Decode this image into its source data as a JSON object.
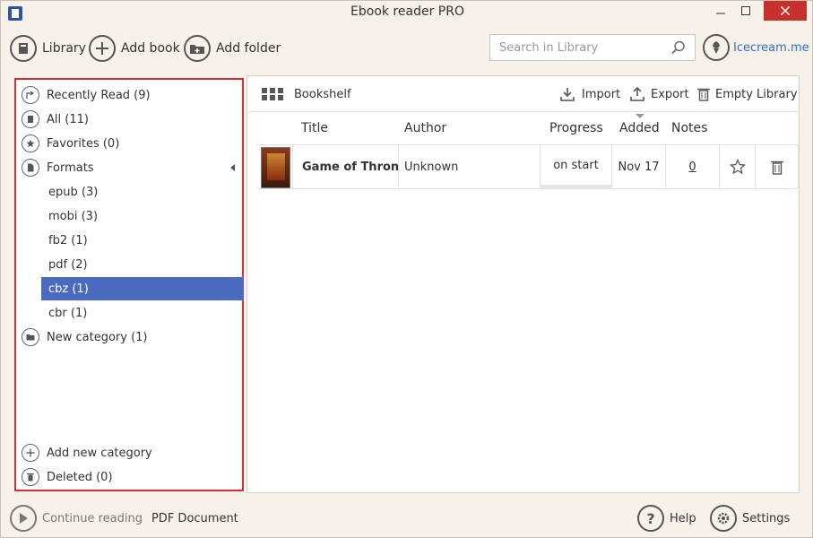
{
  "window": {
    "title": "Ebook reader PRO"
  },
  "toolbar": {
    "library_label": "Library",
    "add_book_label": "Add book",
    "add_folder_label": "Add folder",
    "search_placeholder": "Search in Library",
    "brand_label": "Icecream.me"
  },
  "sidebar": {
    "recently_read": "Recently Read (9)",
    "all": "All (11)",
    "favorites": "Favorites (0)",
    "formats": "Formats",
    "formats_list": [
      "epub (3)",
      "mobi (3)",
      "fb2 (1)",
      "pdf (2)",
      "cbz (1)",
      "cbr (1)"
    ],
    "selected_format": "cbz (1)",
    "new_category": "New category (1)",
    "add_new_category": "Add new category",
    "deleted": "Deleted (0)"
  },
  "main": {
    "view_label": "Bookshelf",
    "import_label": "Import",
    "export_label": "Export",
    "empty_library_label": "Empty Library",
    "columns": [
      "Title",
      "Author",
      "Progress",
      "Added",
      "Notes"
    ],
    "sorted_column": "Added",
    "rows": [
      {
        "title": "Game of Throne",
        "author": "Unknown",
        "progress": "on start",
        "added": "Nov 17",
        "notes": "0"
      }
    ]
  },
  "footer": {
    "continue_label": "Continue reading",
    "current_document": "PDF Document",
    "help_label": "Help",
    "settings_label": "Settings"
  },
  "colors": {
    "accent": "#4a6bbf",
    "highlight_border": "#c8343a",
    "link": "#2e6fc0",
    "close_button": "#c7302b"
  }
}
